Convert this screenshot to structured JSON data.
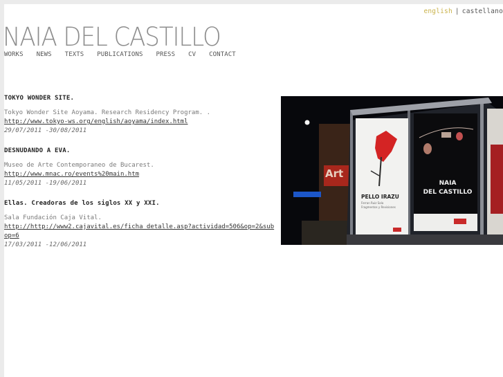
{
  "lang": {
    "active": "english",
    "separator": "|",
    "other": "castellano"
  },
  "brand": "NAIA DEL CASTILLO",
  "nav": [
    "WORKS",
    "NEWS",
    "TEXTS",
    "PUBLICATIONS",
    "PRESS",
    "CV",
    "CONTACT"
  ],
  "news": [
    {
      "title": "TOKYO WONDER SITE.",
      "venue": "Tokyo Wonder Site Aoyama. Research Residency Program. .",
      "link": "http://www.tokyo-ws.org/english/aoyama/index.html",
      "dates": "29/07/2011 -30/08/2011"
    },
    {
      "title": "DESNUDANDO A EVA.",
      "venue": "Museo de Arte Contemporaneo de Bucarest.",
      "link": "http://www.mnac.ro/events%20main.htm",
      "dates": "11/05/2011 -19/06/2011"
    },
    {
      "title": "Ellas. Creadoras de los siglos XX y XXI.",
      "venue": "Sala Fundación Caja Vital.",
      "link": "http://http://www2.cajavital.es/ficha_detalle.asp?actividad=506&op=2&subop=6",
      "dates": "17/03/2011 -12/06/2011"
    }
  ],
  "photo": {
    "poster_left": {
      "line1": "PELLO IRAZU",
      "line2": "Ferran Ruiz Sala",
      "line3": "Fragmentos y Revisiones"
    },
    "poster_right": {
      "line1": "NAIA",
      "line2": "DEL CASTILLO"
    },
    "storefront": "Art"
  }
}
